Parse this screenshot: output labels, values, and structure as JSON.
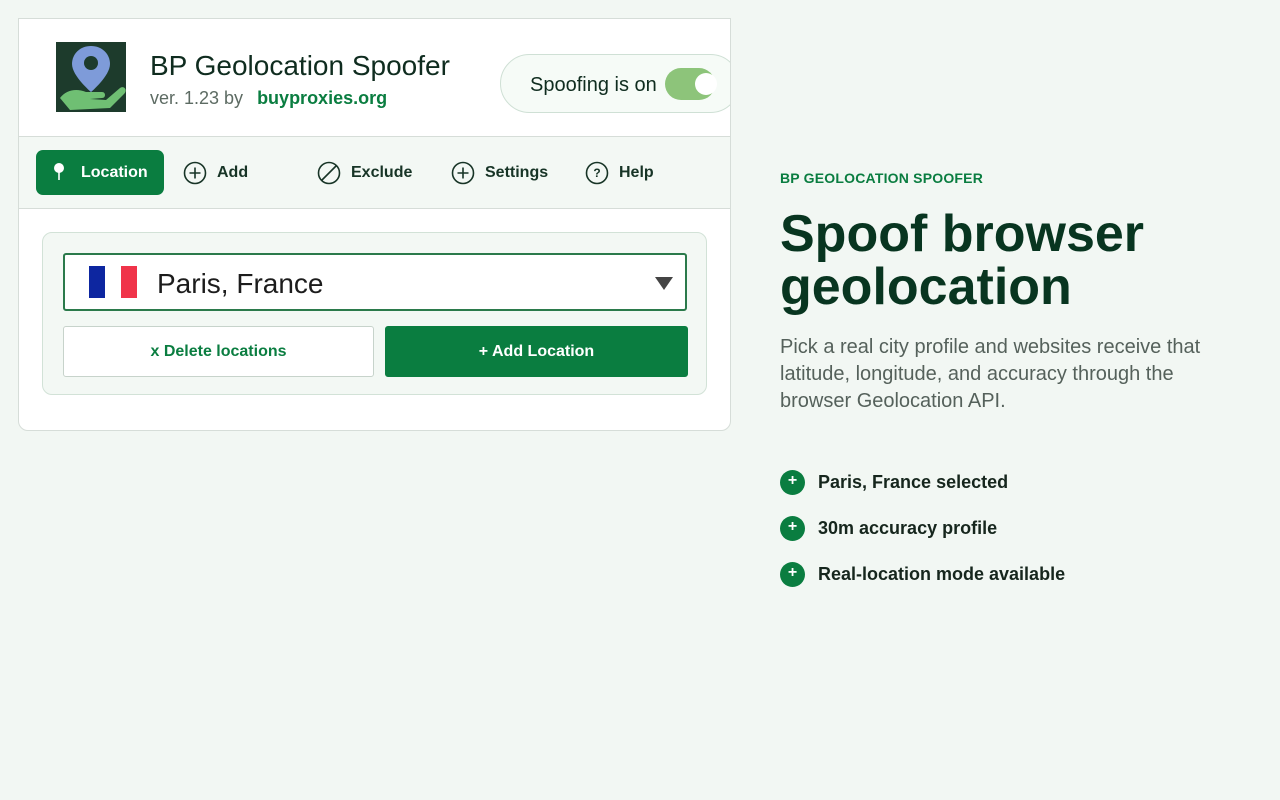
{
  "popup": {
    "title": "BP Geolocation Spoofer",
    "version": "ver. 1.23 by",
    "vendor_link": "buyproxies.org",
    "spoof_status": "Spoofing is on",
    "spoof_enabled": true,
    "logo_icon": "location-pin-hand-icon"
  },
  "tabs": [
    {
      "label": "Location",
      "icon": "location-pin-icon",
      "active": true
    },
    {
      "label": "Add",
      "icon": "plus-circle-icon",
      "active": false
    },
    {
      "label": "Exclude",
      "icon": "prohibit-icon",
      "active": false
    },
    {
      "label": "Settings",
      "icon": "plus-circle-icon",
      "active": false
    },
    {
      "label": "Help",
      "icon": "question-circle-icon",
      "active": false
    }
  ],
  "location": {
    "selected": "Paris, France",
    "flag": "france-flag",
    "delete_label": "x Delete locations",
    "add_label": "+ Add Location"
  },
  "hero": {
    "eyebrow": "BP GEOLOCATION SPOOFER",
    "headline": "Spoof browser geolocation",
    "lead": "Pick a real city profile and websites receive that latitude, longitude, and accuracy through the browser Geolocation API.",
    "features": [
      "Paris, France selected",
      "30m accuracy profile",
      "Real-location mode available"
    ]
  },
  "colors": {
    "brand": "#0a7d40",
    "toggle_on": "#8dc47a",
    "background": "#f2f7f3",
    "headline": "#083520"
  }
}
